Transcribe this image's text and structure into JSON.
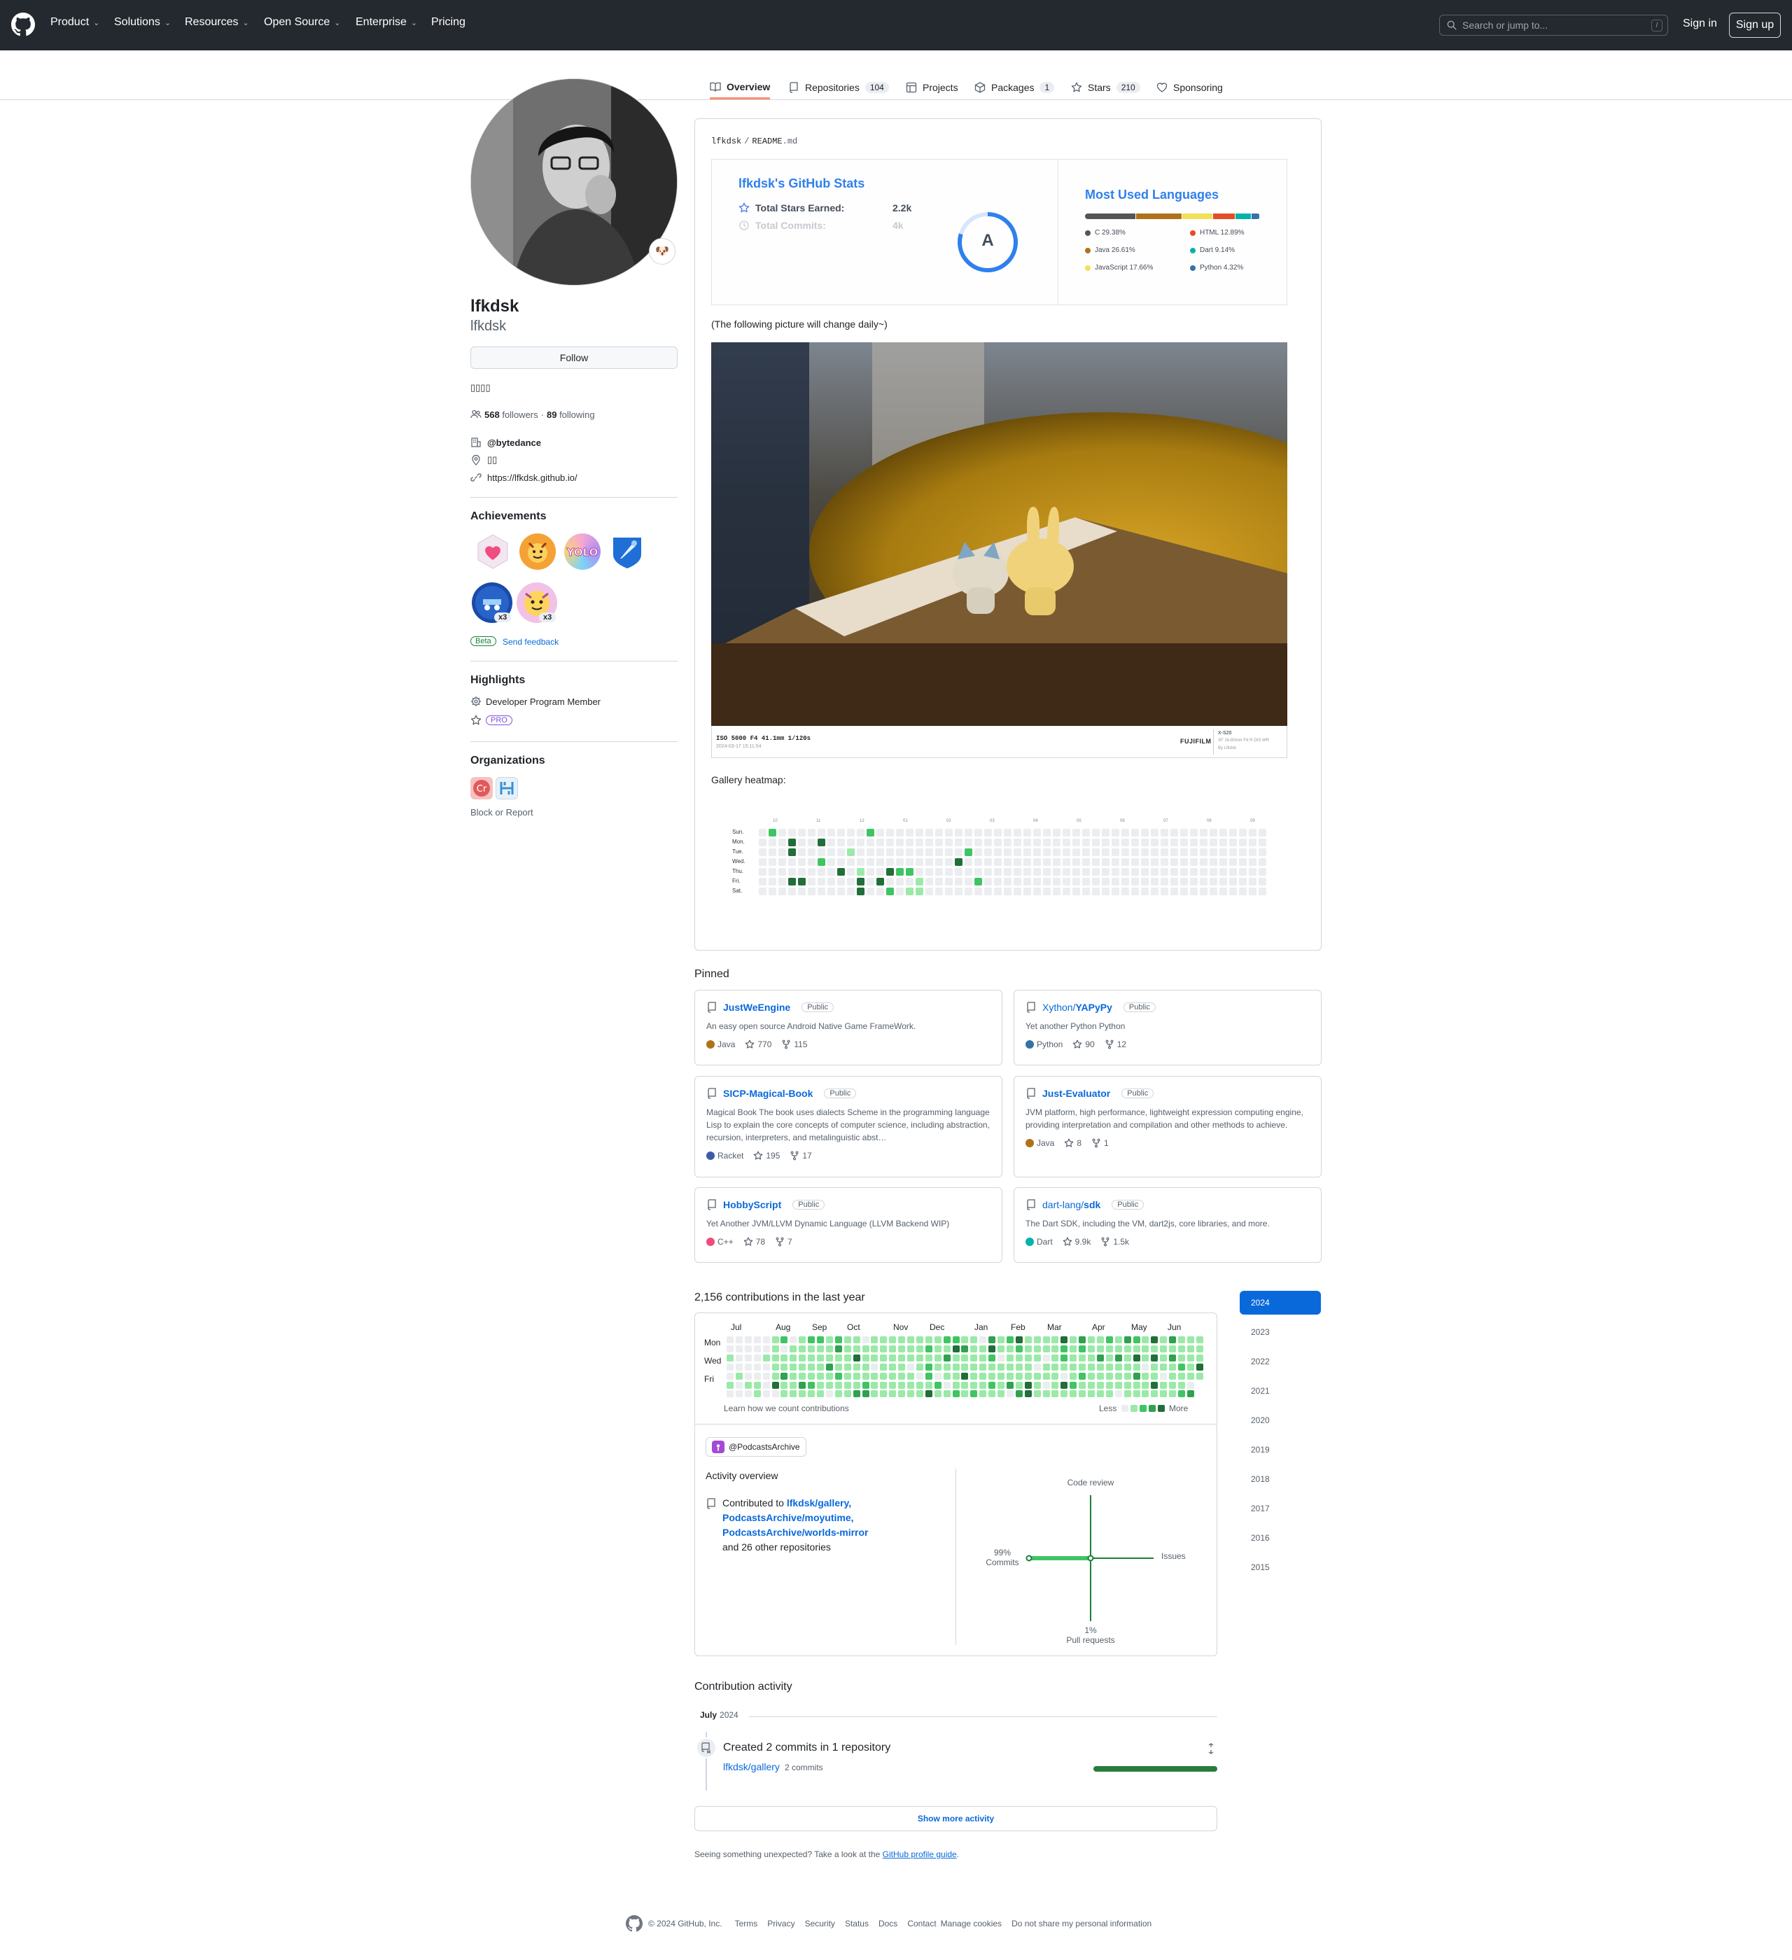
{
  "header": {
    "nav": [
      {
        "label": "Product",
        "caret": true
      },
      {
        "label": "Solutions",
        "caret": true
      },
      {
        "label": "Resources",
        "caret": true
      },
      {
        "label": "Open Source",
        "caret": true
      },
      {
        "label": "Enterprise",
        "caret": true
      },
      {
        "label": "Pricing",
        "caret": false
      }
    ],
    "search_placeholder": "Search or jump to...",
    "search_key": "/",
    "sign_in": "Sign in",
    "sign_up": "Sign up"
  },
  "tabs": [
    {
      "label": "Overview",
      "count": "",
      "icon": "book-icon",
      "selected": true
    },
    {
      "label": "Repositories",
      "count": "104",
      "icon": "repo-icon"
    },
    {
      "label": "Projects",
      "count": "",
      "icon": "table-icon"
    },
    {
      "label": "Packages",
      "count": "1",
      "icon": "package-icon"
    },
    {
      "label": "Stars",
      "count": "210",
      "icon": "star-icon"
    },
    {
      "label": "Sponsoring",
      "count": "",
      "icon": "heart-icon"
    }
  ],
  "profile": {
    "name": "lfkdsk",
    "login": "lfkdsk",
    "follow_label": "Follow",
    "bio": "▯▯▯▯",
    "followers": "568",
    "followers_label": "followers",
    "following": "89",
    "following_label": "following",
    "company": "@bytedance",
    "location": "▯▯",
    "website": "https://lfkdsk.github.io/",
    "status_emoji": "🐶"
  },
  "achievements": {
    "title": "Achievements",
    "badges": [
      {
        "name": "heart-on-sleeve",
        "count": ""
      },
      {
        "name": "pull-shark",
        "count": ""
      },
      {
        "name": "yolo",
        "count": ""
      },
      {
        "name": "starstruck",
        "count": ""
      },
      {
        "name": "pair-extraordinaire",
        "count": "x3"
      },
      {
        "name": "quickdraw",
        "count": "x3"
      }
    ],
    "beta": "Beta",
    "feedback": "Send feedback"
  },
  "highlights": {
    "title": "Highlights",
    "items": [
      "Developer Program Member"
    ],
    "pro": "PRO"
  },
  "organizations": {
    "title": "Organizations"
  },
  "block_report": "Block or Report",
  "readme": {
    "path_user": "lfkdsk",
    "path_sep": "/",
    "path_file": "README",
    "path_ext": ".md",
    "stats": {
      "title": "lfkdsk's GitHub Stats",
      "rows": [
        {
          "label": "Total Stars Earned:",
          "value": "2.2k"
        },
        {
          "label": "Total Commits:",
          "value": "4k"
        }
      ],
      "grade": "A"
    },
    "langs": {
      "title": "Most Used Languages",
      "items": [
        {
          "name": "C",
          "pct": 29.38,
          "label": "C 29.38%",
          "color": "#555555"
        },
        {
          "name": "Java",
          "pct": 26.61,
          "label": "Java 26.61%",
          "color": "#b07219"
        },
        {
          "name": "JavaScript",
          "pct": 17.66,
          "label": "JavaScript 17.66%",
          "color": "#f1e05a"
        },
        {
          "name": "HTML",
          "pct": 12.89,
          "label": "HTML 12.89%",
          "color": "#e34c26"
        },
        {
          "name": "Dart",
          "pct": 9.14,
          "label": "Dart 9.14%",
          "color": "#00B4AB"
        },
        {
          "name": "Python",
          "pct": 4.32,
          "label": "Python 4.32%",
          "color": "#3572A5"
        }
      ]
    },
    "daily_note": "(The following picture will change daily~)",
    "photo_caption": "ISO 5000 F4 41.1mm 1/120s",
    "photo_date": "2024-03-17 15:11:54",
    "photo_brand": "FUJIFILM",
    "photo_model": "X-S20",
    "photo_lens": "XF 16-80mm F4 R OIS WR",
    "photo_author": "By Lfkdsk",
    "heatmap_label": "Gallery heatmap:",
    "heatmap_days": [
      "Sun.",
      "Mon.",
      "Tue.",
      "Wed.",
      "Thu.",
      "Fri.",
      "Sat."
    ],
    "heatmap_months": [
      "10",
      "11",
      "12",
      "01",
      "02",
      "03",
      "04",
      "05",
      "06",
      "07",
      "08",
      "09"
    ]
  },
  "pinned": {
    "title": "Pinned",
    "items": [
      {
        "owner": "",
        "name": "JustWeEngine",
        "badge": "Public",
        "desc": "An easy open source Android Native Game FrameWork.",
        "lang": "Java",
        "lang_color": "#b07219",
        "stars": "770",
        "forks": "115"
      },
      {
        "owner": "Xython/",
        "name": "YAPyPy",
        "badge": "Public",
        "desc": "Yet another Python Python",
        "lang": "Python",
        "lang_color": "#3572A5",
        "stars": "90",
        "forks": "12"
      },
      {
        "owner": "",
        "name": "SICP-Magical-Book",
        "badge": "Public",
        "desc": "Magical Book The book uses dialects Scheme in the programming language Lisp to explain the core concepts of computer science, including abstraction, recursion, interpreters, and metalinguistic abst…",
        "lang": "Racket",
        "lang_color": "#3c5caa",
        "stars": "195",
        "forks": "17"
      },
      {
        "owner": "",
        "name": "Just-Evaluator",
        "badge": "Public",
        "desc": "JVM platform, high performance, lightweight expression computing engine, providing interpretation and compilation and other methods to achieve.",
        "lang": "Java",
        "lang_color": "#b07219",
        "stars": "8",
        "forks": "1"
      },
      {
        "owner": "",
        "name": "HobbyScript",
        "badge": "Public",
        "desc": "Yet Another JVM/LLVM Dynamic Language (LLVM Backend WIP)",
        "lang": "C++",
        "lang_color": "#f34b7d",
        "stars": "78",
        "forks": "7"
      },
      {
        "owner": "dart-lang/",
        "name": "sdk",
        "badge": "Public",
        "desc": "The Dart SDK, including the VM, dart2js, core libraries, and more.",
        "lang": "Dart",
        "lang_color": "#00B4AB",
        "stars": "9.9k",
        "forks": "1.5k"
      }
    ]
  },
  "contrib": {
    "title": "2,156 contributions in the last year",
    "months": [
      "Jul",
      "Aug",
      "Sep",
      "Oct",
      "Nov",
      "Dec",
      "Jan",
      "Feb",
      "Mar",
      "Apr",
      "May",
      "Jun"
    ],
    "days": [
      "Mon",
      "Wed",
      "Fri"
    ],
    "learn": "Learn how we count contributions",
    "less": "Less",
    "more": "More",
    "org": "@PodcastsArchive",
    "activity_title": "Activity overview",
    "contributed_prefix": "Contributed to",
    "repos": [
      "lfkdsk/gallery,",
      "PodcastsArchive/moyutime,",
      "PodcastsArchive/worlds-mirror"
    ],
    "others": "and 26 other repositories",
    "axes": {
      "code_review": "Code review",
      "issues": "Issues",
      "commits_pct": "99%",
      "commits": "Commits",
      "pr_pct": "1%",
      "pr": "Pull requests"
    }
  },
  "years": [
    "2024",
    "2023",
    "2022",
    "2021",
    "2020",
    "2019",
    "2018",
    "2017",
    "2016",
    "2015"
  ],
  "activity": {
    "title": "Contribution activity",
    "month": "July",
    "year": "2024",
    "event": "Created 2 commits in 1 repository",
    "repo": "lfkdsk/gallery",
    "commits": "2 commits",
    "show_more": "Show more activity"
  },
  "unexpected": {
    "text": "Seeing something unexpected? Take a look at the",
    "link": "GitHub profile guide",
    "end": "."
  },
  "footer": {
    "copyright": "© 2024 GitHub, Inc.",
    "links": [
      "Terms",
      "Privacy",
      "Security",
      "Status",
      "Docs",
      "Contact",
      "Manage cookies",
      "Do not share my personal information"
    ]
  }
}
